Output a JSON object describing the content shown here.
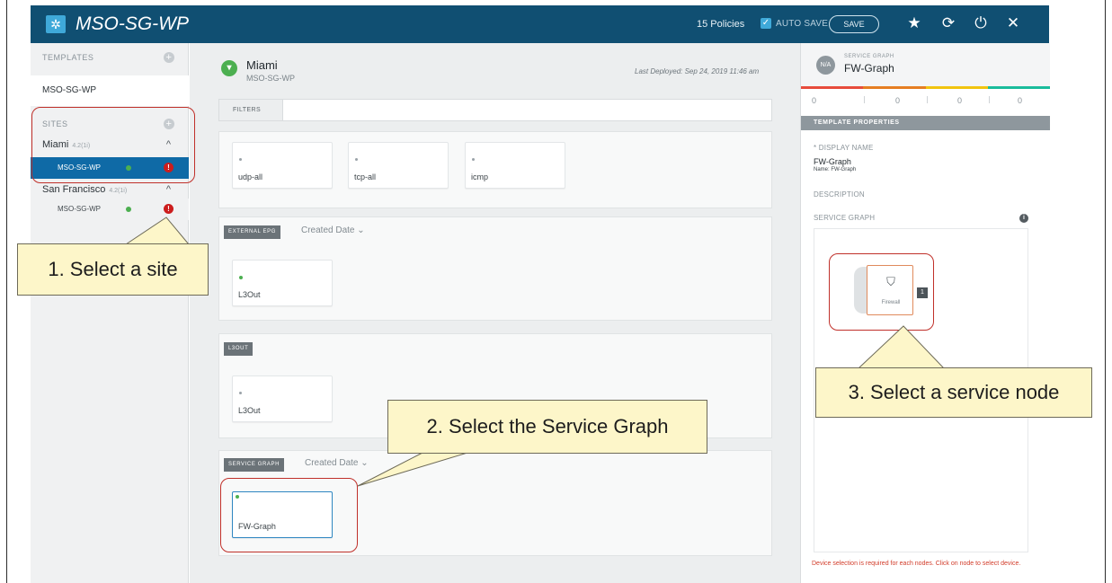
{
  "header": {
    "title": "MSO-SG-WP",
    "policies": "15 Policies",
    "autosave_check": "✓",
    "autosave": "AUTO SAVE",
    "save": "SAVE",
    "icons": [
      "star-icon",
      "refresh-icon",
      "power-icon",
      "close-icon"
    ],
    "icon_glyphs": [
      "★",
      "⟳",
      "⏻",
      "✕"
    ]
  },
  "sidebar": {
    "templates_heading": "TEMPLATES",
    "template_item": "MSO-SG-WP",
    "sites_heading": "SITES",
    "sites": [
      {
        "name": "Miami",
        "version": "4.2(1i)",
        "template": "MSO-SG-WP"
      },
      {
        "name": "San Francisco",
        "version": "4.2(1i)",
        "template": "MSO-SG-WP"
      }
    ]
  },
  "main": {
    "site_name": "Miami",
    "site_template": "MSO-SG-WP",
    "last_deployed": "Last Deployed: Sep 24, 2019 11:46 am",
    "filters_label": "FILTERS",
    "filter_cards": [
      "udp-all",
      "tcp-all",
      "icmp"
    ],
    "external_epg": {
      "tag": "EXTERNAL EPG",
      "sort": "Created Date",
      "cards": [
        "L3Out"
      ]
    },
    "l3out": {
      "tag": "L3OUT",
      "cards": [
        "L3Out"
      ]
    },
    "service_graph": {
      "tag": "SERVICE GRAPH",
      "sort": "Created Date",
      "cards": [
        "FW-Graph"
      ]
    }
  },
  "right_panel": {
    "badge": "N/A",
    "caption": "SERVICE GRAPH",
    "title": "FW-Graph",
    "counts": [
      "0",
      "0",
      "0",
      "0"
    ],
    "colorbar_colors": [
      "#e74c3c",
      "#e67e22",
      "#f1c40f",
      "#1abc9c"
    ],
    "template_properties": "TEMPLATE PROPERTIES",
    "display_name_label": "* DISPLAY NAME",
    "display_name_value": "FW-Graph",
    "display_name_name": "Name: FW-Graph",
    "description_label": "DESCRIPTION",
    "service_graph_label": "SERVICE GRAPH",
    "node_label": "Firewall",
    "node_count": "1",
    "device_note": "Device selection is required for each nodes. Click on node to select device."
  },
  "annotations": {
    "step1": "1. Select a site",
    "step2": "2. Select the Service Graph",
    "step3": "3. Select a service node",
    "ring_color": "#c0302a",
    "callout_color": "#fdf6c9"
  }
}
